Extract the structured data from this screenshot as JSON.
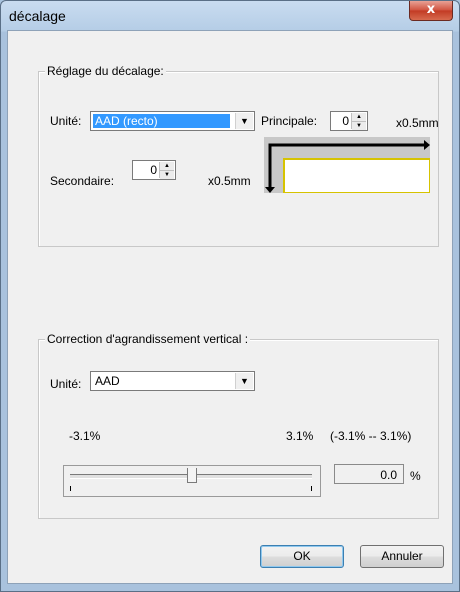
{
  "window": {
    "title": "décalage",
    "close_glyph": "x"
  },
  "offset_group": {
    "legend": "Réglage du décalage:",
    "unit_label": "Unité:",
    "unit_value": "AAD (recto)",
    "main_label": "Principale:",
    "main_value": "0",
    "main_unit": "x0.5mm",
    "secondary_label": "Secondaire:",
    "secondary_value": "0",
    "secondary_unit": "x0.5mm"
  },
  "correction_group": {
    "legend": "Correction d'agrandissement vertical :",
    "unit_label": "Unité:",
    "unit_value": "AAD",
    "min_label": "-3.1%",
    "max_label": "3.1%",
    "range_label": "(-3.1% -- 3.1%)",
    "slider_value": 0.0,
    "value_display": "0.0",
    "percent_sign": "%"
  },
  "buttons": {
    "ok": "OK",
    "cancel": "Annuler"
  },
  "colors": {
    "selection": "#3399ff",
    "close_button": "#c9412a",
    "frame": "#b5cde6"
  }
}
